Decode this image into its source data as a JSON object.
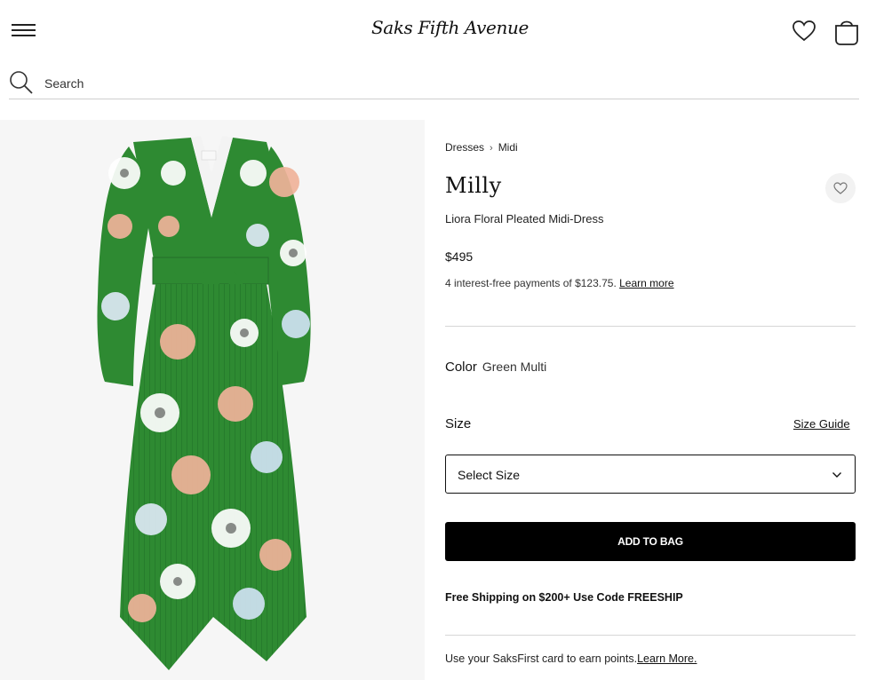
{
  "header": {
    "logo_text": "Saks Fifth Avenue",
    "menu_icon": "hamburger-menu-icon",
    "wishlist_icon": "heart-icon",
    "bag_icon": "shopping-bag-icon"
  },
  "search": {
    "placeholder": "Search",
    "icon": "search-icon"
  },
  "product_image": {
    "alt": "Liora Floral Pleated Midi-Dress",
    "dress_color": "#2e8a32",
    "background": "#f6f6f6"
  },
  "breadcrumb": {
    "items": [
      "Dresses",
      "Midi"
    ],
    "separator": "›"
  },
  "product": {
    "brand": "Milly",
    "name": "Liora Floral Pleated Midi-Dress",
    "price": "$495",
    "installments_text": "4 interest-free payments of $123.75.",
    "installments_link": "Learn more",
    "favorite_icon": "heart-outline-icon"
  },
  "color": {
    "label": "Color",
    "value": "Green Multi"
  },
  "size": {
    "label": "Size",
    "guide_link": "Size Guide",
    "select_placeholder": "Select Size",
    "select_icon": "chevron-down-icon"
  },
  "actions": {
    "add_to_bag": "ADD TO BAG"
  },
  "promo": {
    "shipping": "Free Shipping on $200+ Use Code FREESHIP",
    "saksfirst_text": "Use your SaksFirst card to earn points.",
    "saksfirst_link": "Learn More."
  },
  "colors": {
    "accent": "#000000",
    "divider": "#d6d6d6"
  }
}
